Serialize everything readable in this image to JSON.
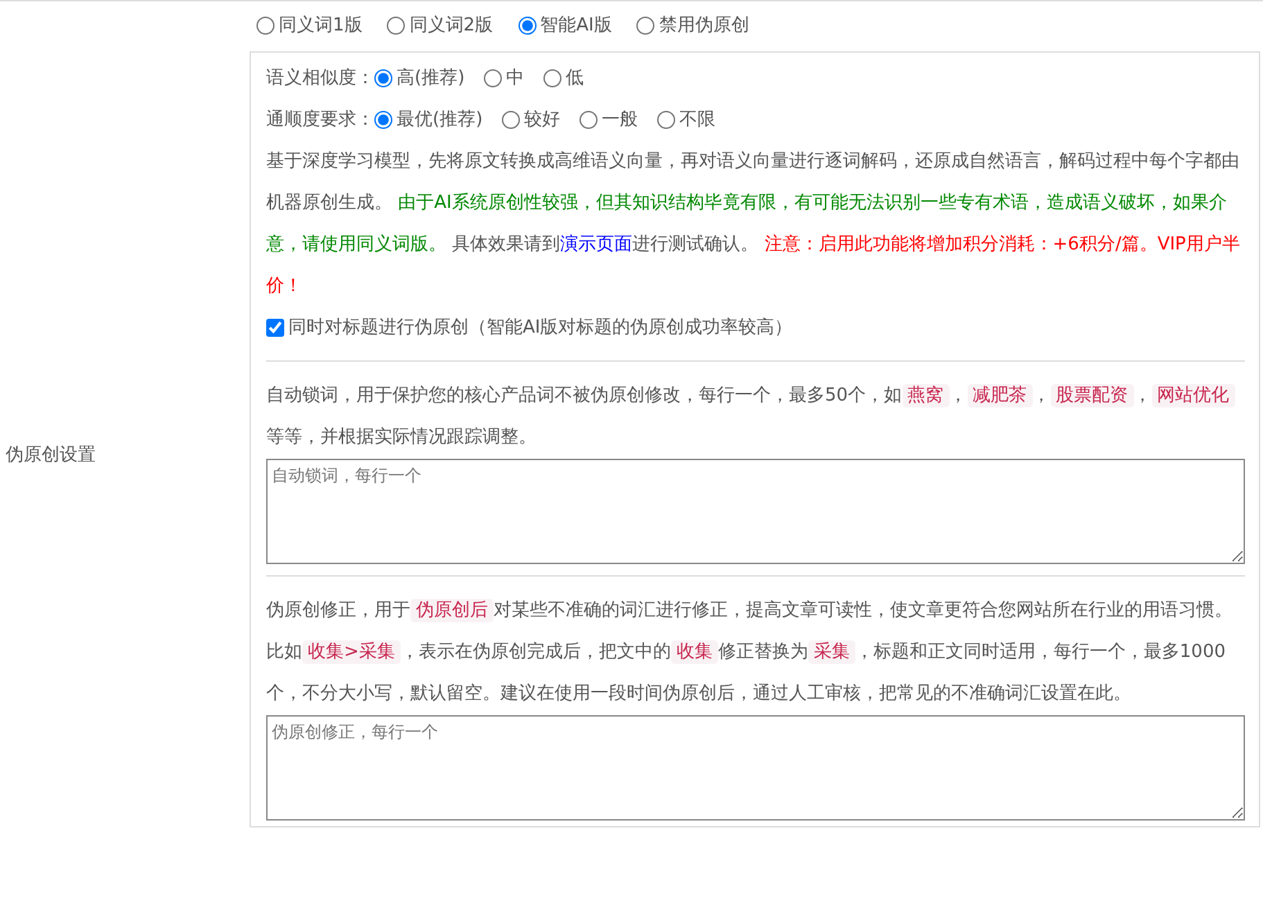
{
  "mode_options": [
    {
      "label": "同义词1版",
      "selected": false
    },
    {
      "label": "同义词2版",
      "selected": false
    },
    {
      "label": "智能AI版",
      "selected": true
    },
    {
      "label": "禁用伪原创",
      "selected": false
    }
  ],
  "side_label": "伪原创设置",
  "similarity": {
    "label": "语义相似度：",
    "options": [
      {
        "label": "高(推荐)",
        "selected": true
      },
      {
        "label": "中",
        "selected": false
      },
      {
        "label": "低",
        "selected": false
      }
    ]
  },
  "fluency": {
    "label": "通顺度要求：",
    "options": [
      {
        "label": "最优(推荐)",
        "selected": true
      },
      {
        "label": "较好",
        "selected": false
      },
      {
        "label": "一般",
        "selected": false
      },
      {
        "label": "不限",
        "selected": false
      }
    ]
  },
  "description": [
    {
      "kind": "plain",
      "text": "基于深度学习模型，先将原文转换成高维语义向量，再对语义向量进行逐词解码，还原成自然语言，解码过程中每个字都由机器原创生成。 "
    },
    {
      "kind": "green",
      "text": "由于AI系统原创性较强，但其知识结构毕竟有限，有可能无法识别一些专有术语，造成语义破坏，如果介意，请使用同义词版。"
    },
    {
      "kind": "plain",
      "text": " 具体效果请到"
    },
    {
      "kind": "link",
      "text": "演示页面"
    },
    {
      "kind": "plain",
      "text": "进行测试确认。 "
    },
    {
      "kind": "red",
      "text": "注意：启用此功能将增加积分消耗：+6积分/篇。VIP用户半价！"
    }
  ],
  "title_option": {
    "label": "同时对标题进行伪原创（智能AI版对标题的伪原创成功率较高）",
    "checked": true
  },
  "lock_words": {
    "description": [
      {
        "kind": "text",
        "text": "自动锁词，用于保护您的核心产品词不被伪原创修改，每行一个，最多50个，如"
      },
      {
        "kind": "code",
        "text": "燕窝"
      },
      {
        "kind": "text",
        "text": "，"
      },
      {
        "kind": "code",
        "text": "减肥茶"
      },
      {
        "kind": "text",
        "text": "，"
      },
      {
        "kind": "code",
        "text": "股票配资"
      },
      {
        "kind": "text",
        "text": "，"
      },
      {
        "kind": "code",
        "text": "网站优化"
      },
      {
        "kind": "text",
        "text": " 等等，并根据实际情况跟踪调整。"
      }
    ],
    "placeholder": "自动锁词，每行一个"
  },
  "corrections": {
    "description": [
      {
        "kind": "text",
        "text": "伪原创修正，用于"
      },
      {
        "kind": "code",
        "text": "伪原创后"
      },
      {
        "kind": "text",
        "text": "对某些不准确的词汇进行修正，提高文章可读性，使文章更符合您网站所在行业的用语习惯。比如"
      },
      {
        "kind": "code",
        "text": "收集>采集"
      },
      {
        "kind": "text",
        "text": "，表示在伪原创完成后，把文中的"
      },
      {
        "kind": "code",
        "text": "收集"
      },
      {
        "kind": "text",
        "text": "修正替换为"
      },
      {
        "kind": "code",
        "text": "采集"
      },
      {
        "kind": "text",
        "text": "，标题和正文同时适用，每行一个，最多1000个，不分大小写，默认留空。建议在使用一段时间伪原创后，通过人工审核，把常见的不准确词汇设置在此。"
      }
    ],
    "placeholder": "伪原创修正，每行一个"
  }
}
